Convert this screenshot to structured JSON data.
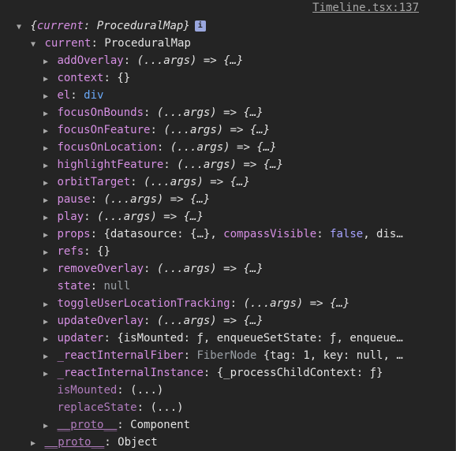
{
  "source_link": "Timeline.tsx:137",
  "summary": {
    "text_open": "{",
    "key": "current",
    "sep": ": ",
    "value": "ProceduralMap",
    "text_close": "}",
    "info_icon": "i"
  },
  "current": {
    "key": "current",
    "sep": ": ",
    "value": "ProceduralMap"
  },
  "props": {
    "addOverlay": {
      "key": "addOverlay",
      "value": "(...args) => {…}"
    },
    "context": {
      "key": "context",
      "value": "{}"
    },
    "el": {
      "key": "el",
      "value": "div"
    },
    "focusOnBounds": {
      "key": "focusOnBounds",
      "value": "(...args) => {…}"
    },
    "focusOnFeature": {
      "key": "focusOnFeature",
      "value": "(...args) => {…}"
    },
    "focusOnLocation": {
      "key": "focusOnLocation",
      "value": "(...args) => {…}"
    },
    "highlightFeature": {
      "key": "highlightFeature",
      "value": "(...args) => {…}"
    },
    "orbitTarget": {
      "key": "orbitTarget",
      "value": "(...args) => {…}"
    },
    "pause": {
      "key": "pause",
      "value": "(...args) => {…}"
    },
    "play": {
      "key": "play",
      "value": "(...args) => {…}"
    },
    "props": {
      "key": "props",
      "p1": "{datasource: {…}, ",
      "k2": "compassVisible",
      "p2": ": ",
      "bool": "false",
      "p3": ", dis…"
    },
    "refs": {
      "key": "refs",
      "value": "{}"
    },
    "removeOverlay": {
      "key": "removeOverlay",
      "value": "(...args) => {…}"
    },
    "state": {
      "key": "state",
      "value": "null"
    },
    "toggleUserLocationTracking": {
      "key": "toggleUserLocationTracking",
      "value": "(...args) => {…}"
    },
    "updateOverlay": {
      "key": "updateOverlay",
      "value": "(...args) => {…}"
    },
    "updater": {
      "key": "updater",
      "value": "{isMounted: ƒ, enqueueSetState: ƒ, enqueue…"
    },
    "reactInternalFiber": {
      "key": "_reactInternalFiber",
      "type": "FiberNode",
      "value": "{tag: 1, key: null, …"
    },
    "reactInternalInstance": {
      "key": "_reactInternalInstance",
      "value": "{_processChildContext: ƒ}"
    },
    "isMounted": {
      "key": "isMounted",
      "value": "(...)"
    },
    "replaceState": {
      "key": "replaceState",
      "value": "(...)"
    },
    "proto_inner": {
      "key": "__proto__",
      "value": "Component"
    },
    "proto_outer": {
      "key": "__proto__",
      "value": "Object"
    }
  }
}
